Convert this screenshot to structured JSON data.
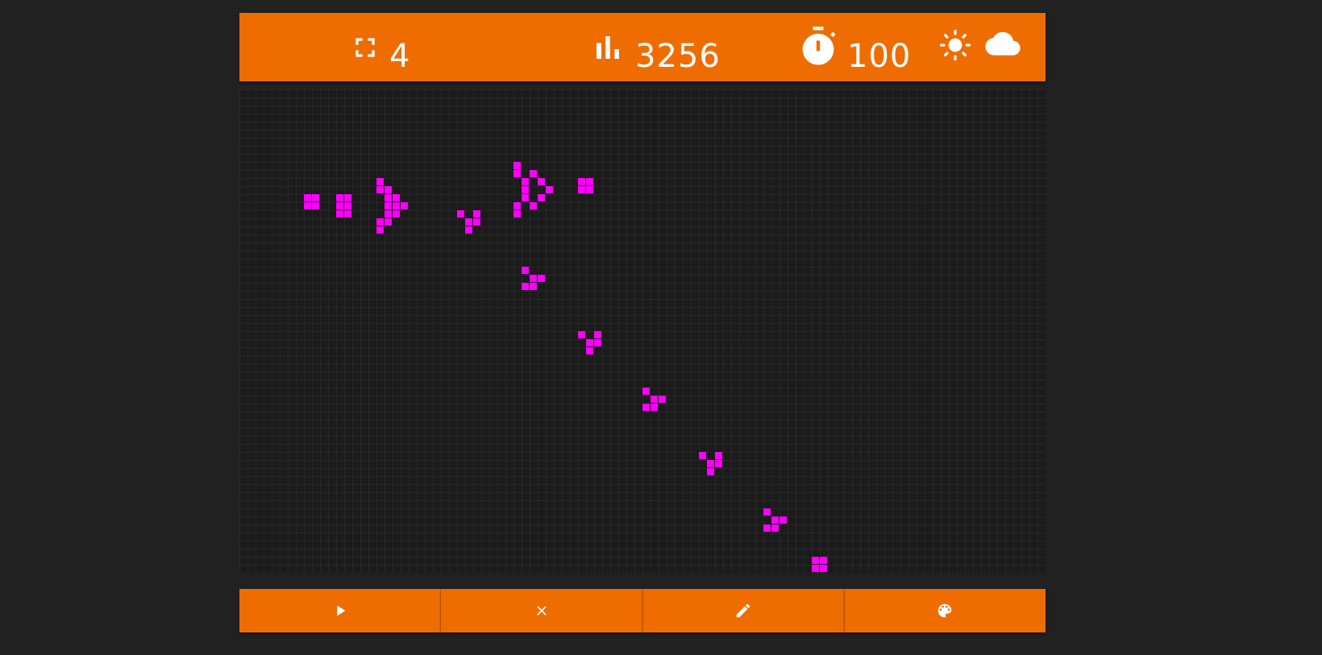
{
  "header": {
    "size_value": "4",
    "generation_value": "3256",
    "speed_value": "100",
    "icons": {
      "size": "fullscreen-icon",
      "generation": "bar-chart-icon",
      "speed": "stopwatch-icon",
      "theme": "brightness-icon",
      "cloud": "cloud-icon"
    }
  },
  "toolbar": {
    "buttons": [
      {
        "name": "play-button",
        "icon": "play-icon"
      },
      {
        "name": "clear-button",
        "icon": "close-icon"
      },
      {
        "name": "edit-button",
        "icon": "pencil-icon"
      },
      {
        "name": "palette-button",
        "icon": "palette-icon"
      }
    ]
  },
  "colors": {
    "accent": "#ef6c00",
    "background": "#212121",
    "grid": "#1b1b1b",
    "cell": "#ff00ff"
  },
  "board": {
    "columns": 100,
    "rows": 60,
    "live_cells": [
      [
        8,
        13
      ],
      [
        9,
        13
      ],
      [
        8,
        14
      ],
      [
        9,
        14
      ],
      [
        12,
        13
      ],
      [
        13,
        13
      ],
      [
        12,
        14
      ],
      [
        13,
        14
      ],
      [
        12,
        15
      ],
      [
        13,
        15
      ],
      [
        17,
        11
      ],
      [
        17,
        12
      ],
      [
        18,
        12
      ],
      [
        18,
        13
      ],
      [
        19,
        13
      ],
      [
        18,
        14
      ],
      [
        19,
        14
      ],
      [
        20,
        14
      ],
      [
        18,
        15
      ],
      [
        19,
        15
      ],
      [
        18,
        16
      ],
      [
        17,
        16
      ],
      [
        17,
        17
      ],
      [
        27,
        15
      ],
      [
        29,
        15
      ],
      [
        28,
        16
      ],
      [
        29,
        16
      ],
      [
        28,
        17
      ],
      [
        34,
        9
      ],
      [
        34,
        10
      ],
      [
        36,
        10
      ],
      [
        35,
        11
      ],
      [
        37,
        11
      ],
      [
        35,
        12
      ],
      [
        38,
        12
      ],
      [
        35,
        13
      ],
      [
        37,
        13
      ],
      [
        34,
        14
      ],
      [
        36,
        14
      ],
      [
        34,
        15
      ],
      [
        42,
        11
      ],
      [
        43,
        11
      ],
      [
        42,
        12
      ],
      [
        43,
        12
      ],
      [
        35,
        22
      ],
      [
        36,
        23
      ],
      [
        37,
        23
      ],
      [
        35,
        24
      ],
      [
        36,
        24
      ],
      [
        42,
        30
      ],
      [
        44,
        30
      ],
      [
        43,
        31
      ],
      [
        44,
        31
      ],
      [
        43,
        32
      ],
      [
        50,
        37
      ],
      [
        51,
        38
      ],
      [
        52,
        38
      ],
      [
        50,
        39
      ],
      [
        51,
        39
      ],
      [
        57,
        45
      ],
      [
        59,
        45
      ],
      [
        58,
        46
      ],
      [
        59,
        46
      ],
      [
        58,
        47
      ],
      [
        65,
        52
      ],
      [
        66,
        53
      ],
      [
        67,
        53
      ],
      [
        65,
        54
      ],
      [
        66,
        54
      ],
      [
        71,
        58
      ],
      [
        72,
        58
      ],
      [
        71,
        59
      ],
      [
        72,
        59
      ]
    ]
  }
}
